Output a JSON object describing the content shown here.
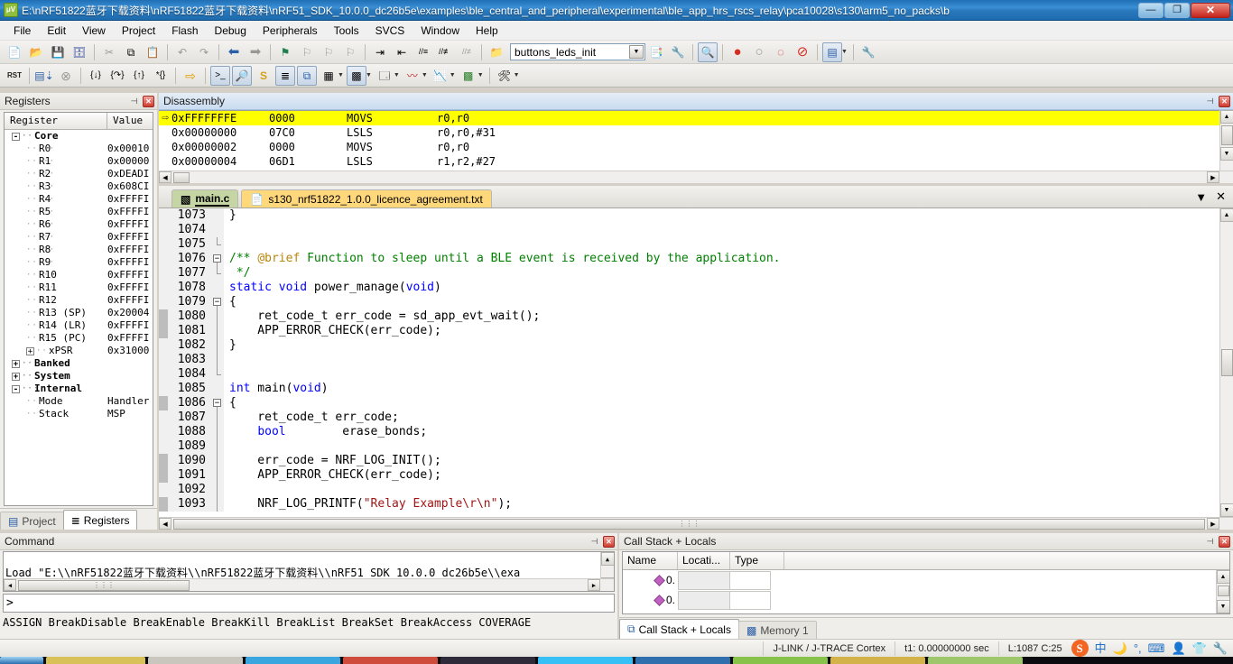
{
  "window": {
    "title": "E:\\nRF51822蓝牙下载资料\\nRF51822蓝牙下载资料\\nRF51_SDK_10.0.0_dc26b5e\\examples\\ble_central_and_peripheral\\experimental\\ble_app_hrs_rscs_relay\\pca10028\\s130\\arm5_no_packs\\b",
    "app_icon": "keil-uvision-icon",
    "minimize_label": "—",
    "maximize_label": "❐",
    "close_label": "✕"
  },
  "menu": {
    "items": [
      "File",
      "Edit",
      "View",
      "Project",
      "Flash",
      "Debug",
      "Peripherals",
      "Tools",
      "SVCS",
      "Window",
      "Help"
    ]
  },
  "toolbar_main": {
    "project_target": "buttons_leds_init",
    "buttons": [
      {
        "name": "new-file-icon",
        "glyph": "📄"
      },
      {
        "name": "open-file-icon",
        "glyph": "📂"
      },
      {
        "name": "save-icon",
        "glyph": "💾"
      },
      {
        "name": "save-all-icon",
        "glyph": "🗄"
      },
      {
        "name": "cut-icon",
        "glyph": "✂"
      },
      {
        "name": "copy-icon",
        "glyph": "⧉"
      },
      {
        "name": "paste-icon",
        "glyph": "📋"
      },
      {
        "name": "undo-icon",
        "glyph": "↶"
      },
      {
        "name": "redo-icon",
        "glyph": "↷"
      },
      {
        "name": "navigate-back-icon",
        "glyph": "⬅"
      },
      {
        "name": "navigate-forward-icon",
        "glyph": "➡"
      },
      {
        "name": "bookmark-toggle-icon",
        "glyph": "⚑"
      },
      {
        "name": "bookmark-prev-icon",
        "glyph": "⚐"
      },
      {
        "name": "bookmark-next-icon",
        "glyph": "⚐"
      },
      {
        "name": "bookmark-clear-icon",
        "glyph": "⚐"
      },
      {
        "name": "indent-icon",
        "glyph": "⇥"
      },
      {
        "name": "outdent-icon",
        "glyph": "⇤"
      },
      {
        "name": "comment-icon",
        "glyph": "//≡"
      },
      {
        "name": "uncomment-icon",
        "glyph": "//≢"
      }
    ]
  },
  "toolbar_debug": {
    "buttons": [
      {
        "name": "reset-cpu-icon",
        "glyph": "RST"
      },
      {
        "name": "run-to-cursor-icon",
        "glyph": "⇩"
      },
      {
        "name": "stop-debug-icon",
        "glyph": "⊗"
      },
      {
        "name": "step-into-icon",
        "glyph": "{↓}"
      },
      {
        "name": "step-over-icon",
        "glyph": "{↷}"
      },
      {
        "name": "step-out-icon",
        "glyph": "{↑}"
      },
      {
        "name": "run-to-line-icon",
        "glyph": "*{}"
      },
      {
        "name": "show-next-statement-icon",
        "glyph": "⇨"
      },
      {
        "name": "command-window-icon",
        "glyph": ">_"
      },
      {
        "name": "disassembly-window-icon",
        "glyph": "🔍"
      },
      {
        "name": "symbols-window-icon",
        "glyph": "S"
      },
      {
        "name": "registers-window-icon",
        "glyph": "≣"
      },
      {
        "name": "call-stack-window-icon",
        "glyph": "⧉"
      },
      {
        "name": "watch-windows-icon",
        "glyph": "▦"
      },
      {
        "name": "memory-windows-icon",
        "glyph": "▩"
      },
      {
        "name": "serial-windows-icon",
        "glyph": "🗔"
      },
      {
        "name": "analysis-windows-icon",
        "glyph": "📈"
      },
      {
        "name": "trace-windows-icon",
        "glyph": "📊"
      },
      {
        "name": "system-viewer-icon",
        "glyph": "🎛"
      },
      {
        "name": "toolbox-icon",
        "glyph": "🛠"
      }
    ]
  },
  "registers": {
    "caption": "Registers",
    "pin_glyph": "⊣",
    "close_glyph": "✕",
    "columns": [
      "Register",
      "Value"
    ],
    "rows": [
      {
        "indent": 0,
        "toggle": "-",
        "name": "Core",
        "value": "",
        "bold": true
      },
      {
        "indent": 1,
        "toggle": "",
        "name": "R0",
        "value": "0x00010"
      },
      {
        "indent": 1,
        "toggle": "",
        "name": "R1",
        "value": "0x00000"
      },
      {
        "indent": 1,
        "toggle": "",
        "name": "R2",
        "value": "0xDEADI"
      },
      {
        "indent": 1,
        "toggle": "",
        "name": "R3",
        "value": "0x608CI"
      },
      {
        "indent": 1,
        "toggle": "",
        "name": "R4",
        "value": "0xFFFFI"
      },
      {
        "indent": 1,
        "toggle": "",
        "name": "R5",
        "value": "0xFFFFI"
      },
      {
        "indent": 1,
        "toggle": "",
        "name": "R6",
        "value": "0xFFFFI"
      },
      {
        "indent": 1,
        "toggle": "",
        "name": "R7",
        "value": "0xFFFFI"
      },
      {
        "indent": 1,
        "toggle": "",
        "name": "R8",
        "value": "0xFFFFI"
      },
      {
        "indent": 1,
        "toggle": "",
        "name": "R9",
        "value": "0xFFFFI"
      },
      {
        "indent": 1,
        "toggle": "",
        "name": "R10",
        "value": "0xFFFFI"
      },
      {
        "indent": 1,
        "toggle": "",
        "name": "R11",
        "value": "0xFFFFI"
      },
      {
        "indent": 1,
        "toggle": "",
        "name": "R12",
        "value": "0xFFFFI"
      },
      {
        "indent": 1,
        "toggle": "",
        "name": "R13 (SP)",
        "value": "0x20004"
      },
      {
        "indent": 1,
        "toggle": "",
        "name": "R14 (LR)",
        "value": "0xFFFFI"
      },
      {
        "indent": 1,
        "toggle": "",
        "name": "R15 (PC)",
        "value": "0xFFFFI"
      },
      {
        "indent": 1,
        "toggle": "+",
        "name": "xPSR",
        "value": "0x31000"
      },
      {
        "indent": 0,
        "toggle": "+",
        "name": "Banked",
        "value": "",
        "bold": true
      },
      {
        "indent": 0,
        "toggle": "+",
        "name": "System",
        "value": "",
        "bold": true
      },
      {
        "indent": 0,
        "toggle": "-",
        "name": "Internal",
        "value": "",
        "bold": true
      },
      {
        "indent": 1,
        "toggle": "",
        "name": "Mode",
        "value": "Handler"
      },
      {
        "indent": 1,
        "toggle": "",
        "name": "Stack",
        "value": "MSP"
      }
    ],
    "tabs": [
      {
        "label": "Project",
        "icon": "project-icon",
        "active": false
      },
      {
        "label": "Registers",
        "icon": "registers-icon",
        "active": true
      }
    ]
  },
  "disassembly": {
    "caption": "Disassembly",
    "pin_glyph": "⊣",
    "close_glyph": "✕",
    "current_arrow": "⇨",
    "lines": [
      {
        "address": "0xFFFFFFFE",
        "opcode": "0000",
        "mnemonic": "MOVS",
        "operands": "r0,r0",
        "current": true
      },
      {
        "address": "0x00000000",
        "opcode": "07C0",
        "mnemonic": "LSLS",
        "operands": "r0,r0,#31",
        "current": false
      },
      {
        "address": "0x00000002",
        "opcode": "0000",
        "mnemonic": "MOVS",
        "operands": "r0,r0",
        "current": false
      },
      {
        "address": "0x00000004",
        "opcode": "06D1",
        "mnemonic": "LSLS",
        "operands": "r1,r2,#27",
        "current": false
      }
    ]
  },
  "editor": {
    "tabs": [
      {
        "label": "main.c",
        "icon": "c-source-icon",
        "active": true
      },
      {
        "label": "s130_nrf51822_1.0.0_licence_agreement.txt",
        "icon": "text-file-icon",
        "active": false
      }
    ],
    "menu_glyph": "▼",
    "close_glyph": "✕",
    "lines": [
      {
        "no": "1073",
        "fold": "",
        "exec": false,
        "segments": [
          {
            "t": "}",
            "c": ""
          }
        ]
      },
      {
        "no": "1074",
        "fold": "",
        "exec": false,
        "segments": []
      },
      {
        "no": "1075",
        "fold": "end",
        "exec": false,
        "segments": []
      },
      {
        "no": "1076",
        "fold": "box-minus",
        "exec": false,
        "segments": [
          {
            "t": "/** ",
            "c": "cm"
          },
          {
            "t": "@brief",
            "c": "docdir"
          },
          {
            "t": " Function to sleep until a BLE event is received by the application.",
            "c": "cm"
          }
        ]
      },
      {
        "no": "1077",
        "fold": "end",
        "exec": false,
        "segments": [
          {
            "t": " */",
            "c": "cm"
          }
        ]
      },
      {
        "no": "1078",
        "fold": "",
        "exec": false,
        "segments": [
          {
            "t": "static",
            "c": "kw"
          },
          {
            "t": " ",
            "c": ""
          },
          {
            "t": "void",
            "c": "kw"
          },
          {
            "t": " power_manage(",
            "c": ""
          },
          {
            "t": "void",
            "c": "kw"
          },
          {
            "t": ")",
            "c": ""
          }
        ]
      },
      {
        "no": "1079",
        "fold": "box-minus",
        "exec": false,
        "segments": [
          {
            "t": "{",
            "c": ""
          }
        ]
      },
      {
        "no": "1080",
        "fold": "bar",
        "exec": true,
        "segments": [
          {
            "t": "    ret_code_t err_code = sd_app_evt_wait();",
            "c": ""
          }
        ]
      },
      {
        "no": "1081",
        "fold": "bar",
        "exec": true,
        "segments": [
          {
            "t": "    APP_ERROR_CHECK(err_code);",
            "c": ""
          }
        ]
      },
      {
        "no": "1082",
        "fold": "bar",
        "exec": false,
        "segments": [
          {
            "t": "}",
            "c": ""
          }
        ]
      },
      {
        "no": "1083",
        "fold": "bar",
        "exec": false,
        "segments": []
      },
      {
        "no": "1084",
        "fold": "end",
        "exec": false,
        "segments": []
      },
      {
        "no": "1085",
        "fold": "",
        "exec": false,
        "segments": [
          {
            "t": "int",
            "c": "kw"
          },
          {
            "t": " main(",
            "c": ""
          },
          {
            "t": "void",
            "c": "kw"
          },
          {
            "t": ")",
            "c": ""
          }
        ]
      },
      {
        "no": "1086",
        "fold": "box-minus",
        "exec": true,
        "segments": [
          {
            "t": "{",
            "c": ""
          }
        ]
      },
      {
        "no": "1087",
        "fold": "bar",
        "exec": false,
        "segments": [
          {
            "t": "    ret_code_t err_code;",
            "c": ""
          }
        ]
      },
      {
        "no": "1088",
        "fold": "bar",
        "exec": false,
        "segments": [
          {
            "t": "    ",
            "c": ""
          },
          {
            "t": "bool",
            "c": "kw"
          },
          {
            "t": "        erase_bonds;",
            "c": ""
          }
        ]
      },
      {
        "no": "1089",
        "fold": "bar",
        "exec": false,
        "segments": []
      },
      {
        "no": "1090",
        "fold": "bar",
        "exec": true,
        "segments": [
          {
            "t": "    err_code = NRF_LOG_INIT();",
            "c": ""
          }
        ]
      },
      {
        "no": "1091",
        "fold": "bar",
        "exec": true,
        "segments": [
          {
            "t": "    APP_ERROR_CHECK(err_code);",
            "c": ""
          }
        ]
      },
      {
        "no": "1092",
        "fold": "bar",
        "exec": false,
        "segments": []
      },
      {
        "no": "1093",
        "fold": "bar",
        "exec": true,
        "segments": [
          {
            "t": "    NRF_LOG_PRINTF(",
            "c": ""
          },
          {
            "t": "\"Relay Example\\r\\n\"",
            "c": "str"
          },
          {
            "t": ");",
            "c": ""
          }
        ]
      }
    ]
  },
  "command": {
    "caption": "Command",
    "pin_glyph": "⊣",
    "close_glyph": "✕",
    "output": "Load \"E:\\\\nRF51822蓝牙下载资料\\\\nRF51822蓝牙下载资料\\\\nRF51 SDK 10.0.0 dc26b5e\\\\exa",
    "prompt": ">",
    "input_value": "",
    "help_line": "ASSIGN BreakDisable BreakEnable BreakKill BreakList BreakSet BreakAccess COVERAGE"
  },
  "callstack": {
    "caption": "Call Stack + Locals",
    "pin_glyph": "⊣",
    "close_glyph": "✕",
    "columns": [
      "Name",
      "Locati...",
      "Type"
    ],
    "rows": [
      {
        "name": "0.",
        "location": "",
        "type": ""
      },
      {
        "name": "0.",
        "location": "",
        "type": ""
      }
    ],
    "tabs": [
      {
        "label": "Call Stack + Locals",
        "icon": "call-stack-icon",
        "active": true
      },
      {
        "label": "Memory 1",
        "icon": "memory-icon",
        "active": false
      }
    ]
  },
  "statusbar": {
    "debugger": "J-LINK / J-TRACE Cortex",
    "time": "t1: 0.00000000 sec",
    "cursor": "L:1087 C:25",
    "tray": [
      {
        "name": "sogou-input-icon",
        "glyph": "S"
      },
      {
        "name": "chinese-mode-icon",
        "glyph": "中"
      },
      {
        "name": "moon-icon",
        "glyph": "🌙"
      },
      {
        "name": "punctuation-icon",
        "glyph": "°,"
      },
      {
        "name": "keyboard-icon",
        "glyph": "⌨"
      },
      {
        "name": "user-icon",
        "glyph": "👤"
      },
      {
        "name": "skin-icon",
        "glyph": "👕"
      },
      {
        "name": "toolbox-wrench-icon",
        "glyph": "🔧"
      }
    ]
  },
  "colors": {
    "title_blue": "#2a79bd",
    "highlight_yellow": "#ffff00",
    "tab_active_green": "#c5d5a4",
    "tab_doc_orange": "#ffd87c",
    "keyword_blue": "#0000ff",
    "comment_green": "#008000",
    "string_red": "#a31515"
  }
}
